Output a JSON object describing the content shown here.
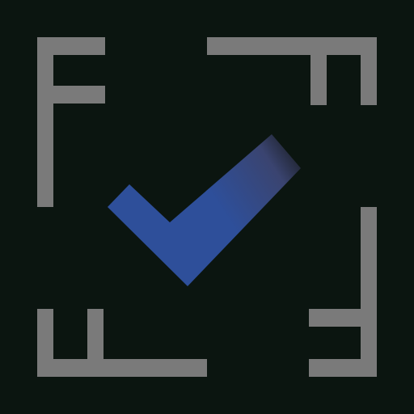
{
  "logo": {
    "description_free_graphic": true,
    "colors": {
      "background": "#0b1510",
      "corner_marks": "#7a7a7a",
      "check_start": "#2e4f9a",
      "check_end": "#2a2a35"
    },
    "icons": [
      "corner-f-top-left",
      "corner-f-top-right",
      "corner-f-bottom-left",
      "corner-f-bottom-right",
      "checkmark-icon"
    ]
  }
}
